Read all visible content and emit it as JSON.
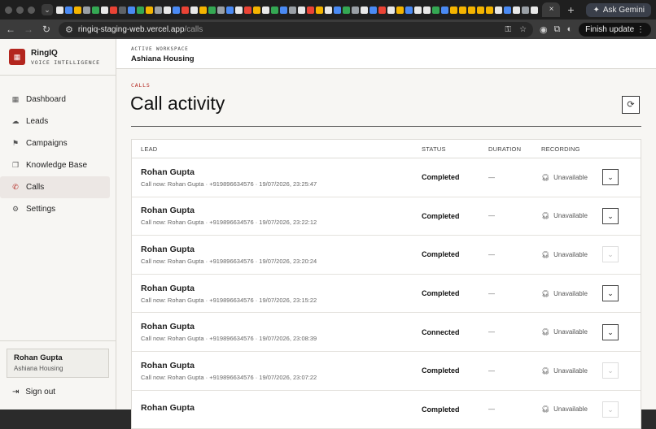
{
  "browser": {
    "url_host": "ringiq-staging-web.vercel.app",
    "url_path": "/calls",
    "tab_close": "×",
    "new_tab": "+",
    "ask_gemini": "Ask Gemini",
    "finish_update": "Finish update"
  },
  "app": {
    "brand_name": "RingIQ",
    "brand_sub": "VOICE INTELLIGENCE",
    "workspace_label": "ACTIVE WORKSPACE",
    "workspace_name": "Ashiana Housing",
    "nav": [
      {
        "label": "Dashboard",
        "icon": "grid-icon"
      },
      {
        "label": "Leads",
        "icon": "cloud-icon"
      },
      {
        "label": "Campaigns",
        "icon": "megaphone-icon"
      },
      {
        "label": "Knowledge Base",
        "icon": "book-icon"
      },
      {
        "label": "Calls",
        "icon": "phone-icon",
        "active": true
      },
      {
        "label": "Settings",
        "icon": "gear-icon"
      }
    ],
    "user": {
      "name": "Rohan Gupta",
      "org": "Ashiana Housing"
    },
    "sign_out": "Sign out",
    "accent": "#b3261e"
  },
  "page": {
    "crumb": "CALLS",
    "title": "Call activity"
  },
  "table": {
    "headers": {
      "lead": "LEAD",
      "status": "STATUS",
      "duration": "DURATION",
      "recording": "RECORDING"
    },
    "rows": [
      {
        "name": "Rohan Gupta",
        "sub": "Call now: Rohan Gupta · +919896634576 · 19/07/2026, 23:25:47",
        "status": "Completed",
        "duration": "—",
        "recording": "Unavailable",
        "expand_enabled": true
      },
      {
        "name": "Rohan Gupta",
        "sub": "Call now: Rohan Gupta · +919896634576 · 19/07/2026, 23:22:12",
        "status": "Completed",
        "duration": "—",
        "recording": "Unavailable",
        "expand_enabled": true
      },
      {
        "name": "Rohan Gupta",
        "sub": "Call now: Rohan Gupta · +919896634576 · 19/07/2026, 23:20:24",
        "status": "Completed",
        "duration": "—",
        "recording": "Unavailable",
        "expand_enabled": false
      },
      {
        "name": "Rohan Gupta",
        "sub": "Call now: Rohan Gupta · +919896634576 · 19/07/2026, 23:15:22",
        "status": "Completed",
        "duration": "—",
        "recording": "Unavailable",
        "expand_enabled": true
      },
      {
        "name": "Rohan Gupta",
        "sub": "Call now: Rohan Gupta · +919896634576 · 19/07/2026, 23:08:39",
        "status": "Connected",
        "duration": "—",
        "recording": "Unavailable",
        "expand_enabled": true
      },
      {
        "name": "Rohan Gupta",
        "sub": "Call now: Rohan Gupta · +919896634576 · 19/07/2026, 23:07:22",
        "status": "Completed",
        "duration": "—",
        "recording": "Unavailable",
        "expand_enabled": false
      },
      {
        "name": "Rohan Gupta",
        "sub": "",
        "status": "Completed",
        "duration": "—",
        "recording": "Unavailable",
        "expand_enabled": false
      }
    ]
  }
}
